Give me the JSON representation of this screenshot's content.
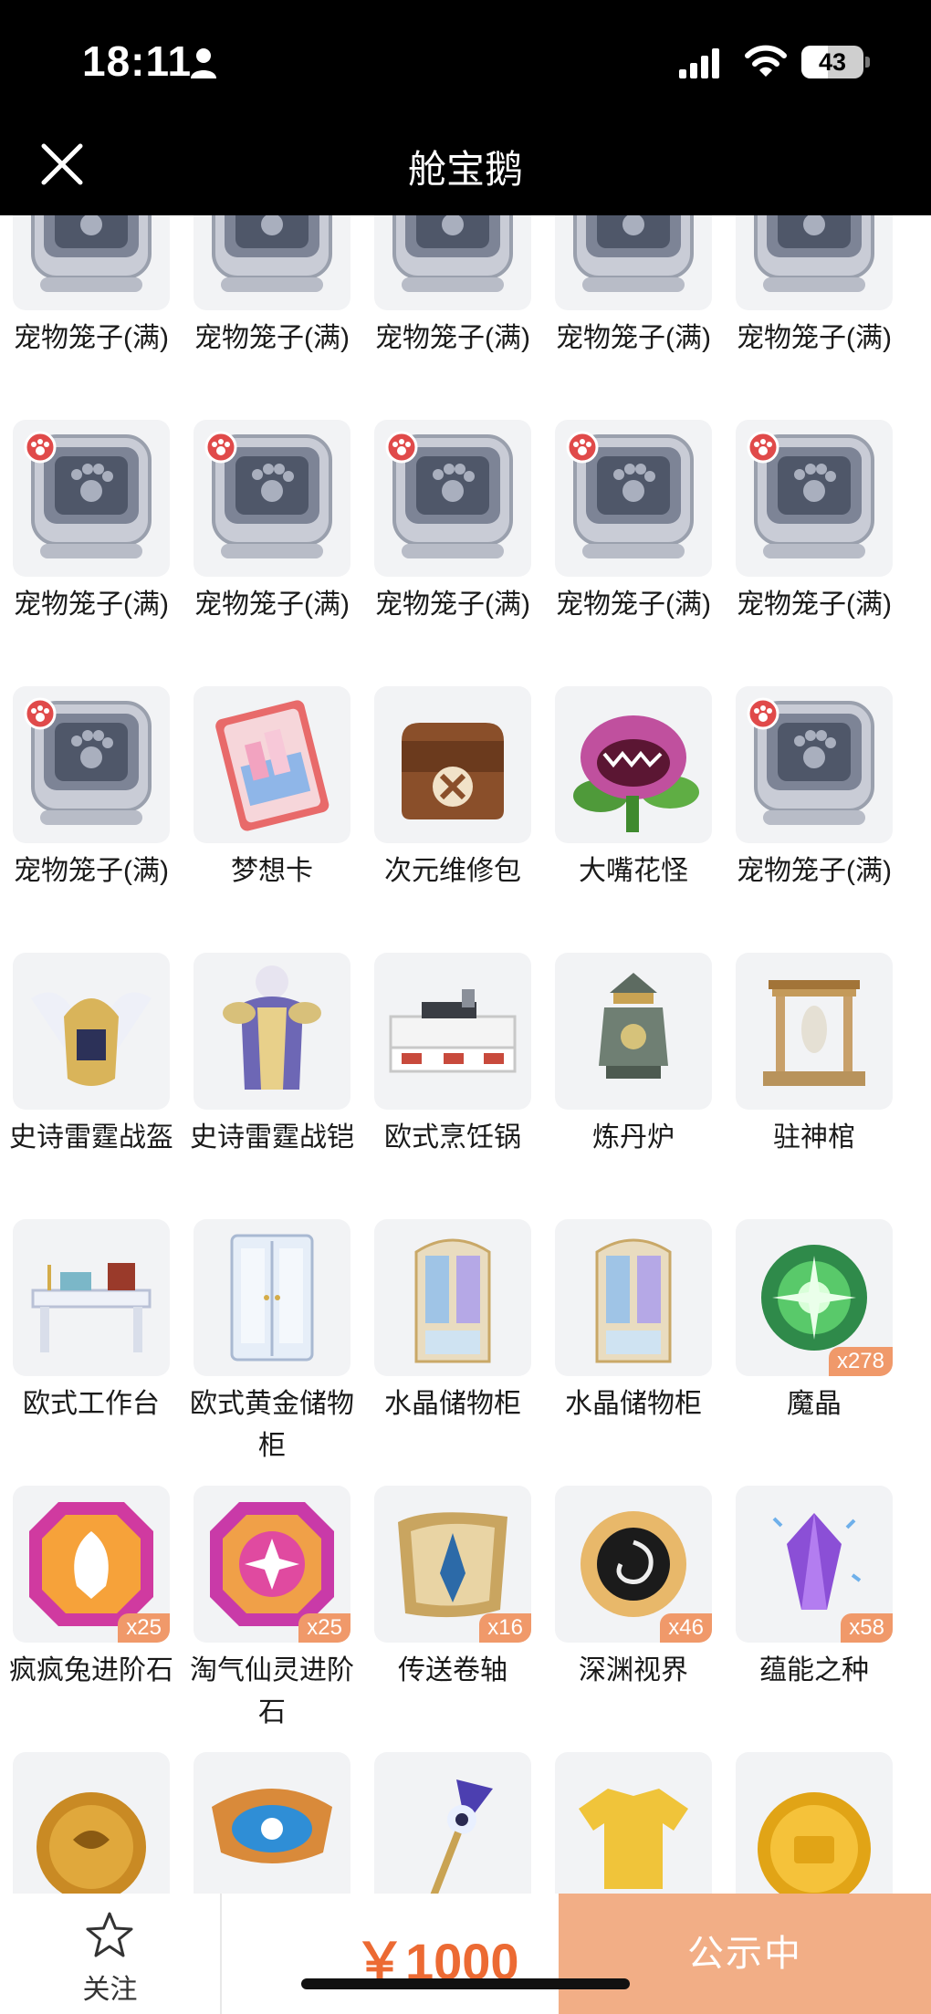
{
  "status_bar": {
    "time": "18:11",
    "battery": "43",
    "battery_level": 0.43
  },
  "header": {
    "title": "舱宝鹅"
  },
  "rows": [
    [
      {
        "art": "cage",
        "name": "宠物笼子(满)",
        "qty": ""
      },
      {
        "art": "cage",
        "name": "宠物笼子(满)",
        "qty": ""
      },
      {
        "art": "cage",
        "name": "宠物笼子(满)",
        "qty": ""
      },
      {
        "art": "cage",
        "name": "宠物笼子(满)",
        "qty": ""
      },
      {
        "art": "cage",
        "name": "宠物笼子(满)",
        "qty": ""
      }
    ],
    [
      {
        "art": "cage-badge",
        "name": "宠物笼子(满)",
        "qty": ""
      },
      {
        "art": "cage-badge",
        "name": "宠物笼子(满)",
        "qty": ""
      },
      {
        "art": "cage-badge",
        "name": "宠物笼子(满)",
        "qty": ""
      },
      {
        "art": "cage-badge",
        "name": "宠物笼子(满)",
        "qty": ""
      },
      {
        "art": "cage-badge",
        "name": "宠物笼子(满)",
        "qty": ""
      }
    ],
    [
      {
        "art": "cage-badge",
        "name": "宠物笼子(满)",
        "qty": ""
      },
      {
        "art": "card",
        "name": "梦想卡",
        "qty": ""
      },
      {
        "art": "repair-bag",
        "name": "次元维修包",
        "qty": ""
      },
      {
        "art": "flower",
        "name": "大嘴花怪",
        "qty": ""
      },
      {
        "art": "cage-badge",
        "name": "宠物笼子(满)",
        "qty": ""
      }
    ],
    [
      {
        "art": "helmet",
        "name": "史诗雷霆战盔",
        "qty": ""
      },
      {
        "art": "armor",
        "name": "史诗雷霆战铠",
        "qty": ""
      },
      {
        "art": "stove",
        "name": "欧式烹饪锅",
        "qty": ""
      },
      {
        "art": "furnace",
        "name": "炼丹炉",
        "qty": ""
      },
      {
        "art": "shrine",
        "name": "驻神棺",
        "qty": ""
      }
    ],
    [
      {
        "art": "desk",
        "name": "欧式工作台",
        "qty": ""
      },
      {
        "art": "wardrobe",
        "name": "欧式黄金储物柜",
        "qty": ""
      },
      {
        "art": "cabinet",
        "name": "水晶储物柜",
        "qty": ""
      },
      {
        "art": "cabinet",
        "name": "水晶储物柜",
        "qty": ""
      },
      {
        "art": "orb",
        "name": "魔晶",
        "qty": "x278"
      }
    ],
    [
      {
        "art": "gem-rabbit",
        "name": "疯疯兔进阶石",
        "qty": "x25"
      },
      {
        "art": "gem-fairy",
        "name": "淘气仙灵进阶石",
        "qty": "x25"
      },
      {
        "art": "scroll",
        "name": "传送卷轴",
        "qty": "x16"
      },
      {
        "art": "abyss",
        "name": "深渊视界",
        "qty": "x46"
      },
      {
        "art": "crystal",
        "name": "蕴能之种",
        "qty": "x58"
      }
    ],
    [
      {
        "art": "coin-bronze",
        "name": "",
        "qty": ""
      },
      {
        "art": "eye-emblem",
        "name": "",
        "qty": ""
      },
      {
        "art": "staff",
        "name": "",
        "qty": ""
      },
      {
        "art": "shirt",
        "name": "",
        "qty": ""
      },
      {
        "art": "coin-gold",
        "name": "",
        "qty": ""
      }
    ]
  ],
  "footer": {
    "follow_label": "关注",
    "price": "￥1000",
    "status_label": "公示中"
  },
  "colors": {
    "accent": "#ec6a33",
    "status_button": "#f2ae86",
    "qty_badge": "#f0996a",
    "tile_bg": "#f2f3f5"
  }
}
